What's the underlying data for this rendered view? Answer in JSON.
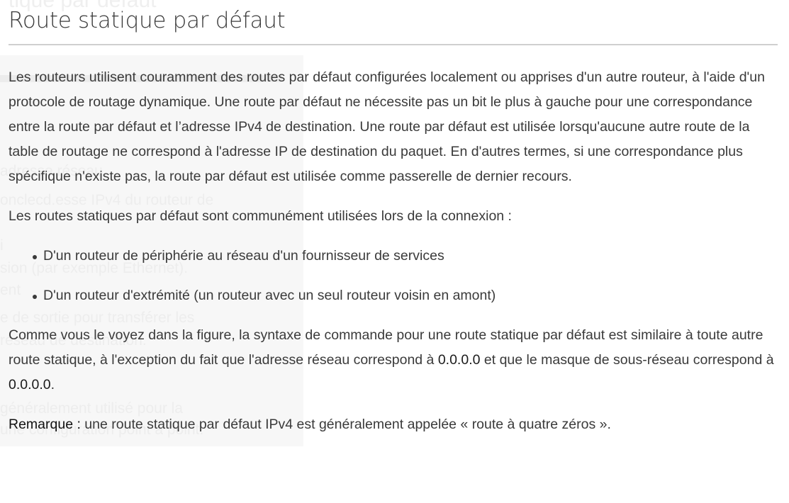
{
  "ghost": {
    "title": "tique par défaut",
    "lines": [
      "adresse réseau.",
      "onclecd.esse IPv4 du routeur de",
      "i",
      "sion (par exemple Ethernet).",
      "ent",
      "e de sortie pour transférer les",
      "réseau de destination.",
      "",
      "généralement utilisé pour la",
      "une configuration point à point."
    ]
  },
  "page": {
    "title": "Route statique par défaut"
  },
  "paragraphs": {
    "intro": "Les routeurs utilisent couramment des routes par défaut configurées localement ou apprises d'un autre routeur, à l'aide d'un protocole de routage dynamique. Une route par défaut ne nécessite pas un bit le plus à gauche pour une correspondance entre la route par défaut et l’adresse IPv4 de destination. Une route par défaut est utilisée lorsqu'aucune autre route de la table de routage ne correspond à l'adresse IP de destination du paquet. En d'autres termes, si une correspondance plus spécifique n'existe pas, la route par défaut est utilisée comme passerelle de dernier recours.",
    "usage_intro": "Les routes statiques par défaut sont communément utilisées lors de la connexion :",
    "bullets": [
      "D'un routeur de périphérie au réseau d'un fournisseur de services",
      "D'un routeur d'extrémité (un routeur avec un seul routeur voisin en amont)"
    ],
    "syntax": {
      "part1": "Comme vous le voyez dans la figure, la syntaxe de commande pour une route statique par défaut est similaire à toute autre route statique, à l'exception du fait que l'adresse réseau correspond à ",
      "network": "0.0.0.0",
      "part2": " et que le masque de sous-réseau correspond à ",
      "mask": "0.0.0.0",
      "part3": "."
    },
    "remark": {
      "label": "Remarque :",
      "text": " une route statique par défaut IPv4 est généralement appelée « route à quatre zéros »."
    }
  }
}
